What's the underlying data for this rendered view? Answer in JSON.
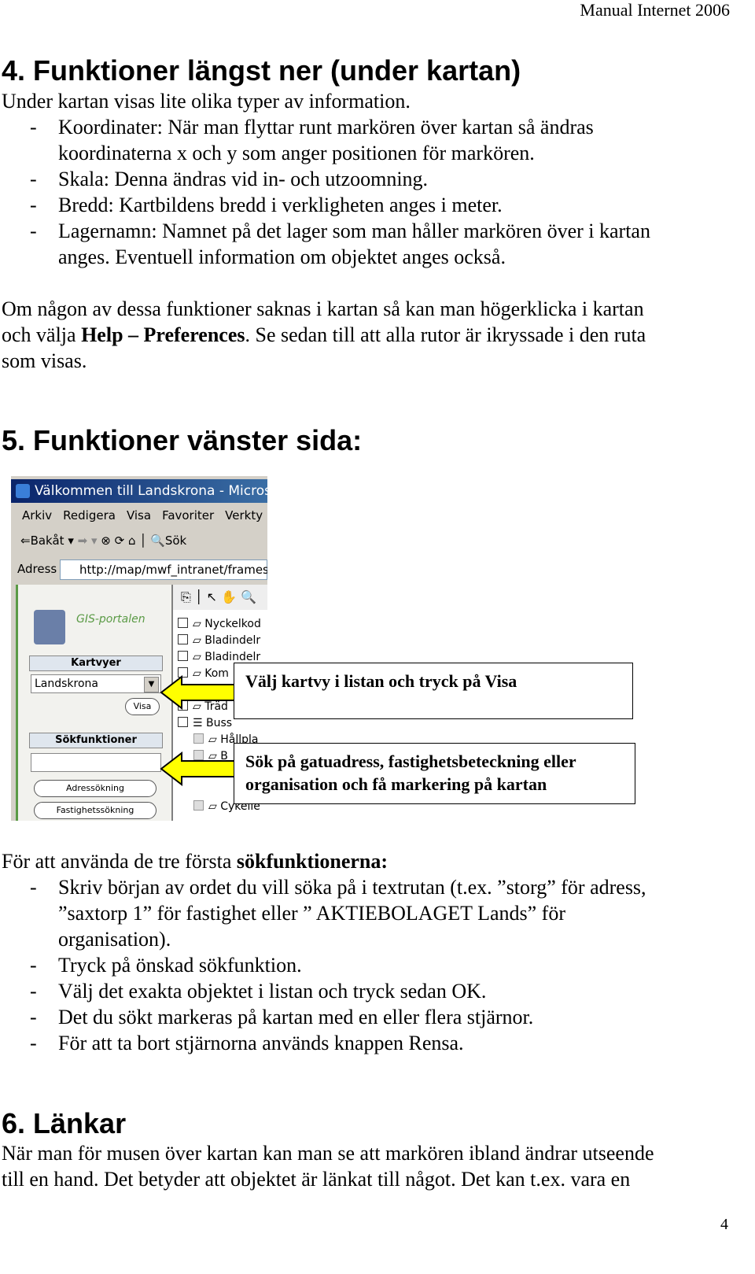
{
  "header": "Manual Internet 2006",
  "page_number": "4",
  "s4": {
    "title": "4. Funktioner längst ner (under kartan)",
    "lines": [
      "Under kartan visas lite olika typer av information.",
      "Koordinater: När man flyttar runt markören över kartan så ändras",
      "koordinaterna x och y som anger positionen för markören.",
      "Skala: Denna ändras vid in- och utzoomning.",
      "Bredd: Kartbildens bredd i verkligheten anges i meter.",
      "Lagernamn: Namnet på det lager som man håller markören över i kartan",
      "anges. Eventuell information om objektet anges också."
    ],
    "p1a": "Om någon av dessa funktioner saknas i kartan så kan man högerklicka i kartan",
    "p1b_pre": "och välja ",
    "p1b_bold": "Help – Preferences",
    "p1b_post": ". Se sedan till att alla rutor är ikryssade i den ruta",
    "p1c": "som visas."
  },
  "s5": {
    "title": "5. Funktioner vänster sida:",
    "screenshot": {
      "title": "Välkommen till Landskrona - Microsc",
      "menu": [
        "Arkiv",
        "Redigera",
        "Visa",
        "Favoriter",
        "Verkty"
      ],
      "back": "Bakåt",
      "search": "Sök",
      "address_label": "Adress",
      "address": "http://map/mwf_intranet/frames",
      "gis": "GIS-portalen",
      "kartvyer": "Kartvyer",
      "kartvy_value": "Landskrona",
      "visa": "Visa",
      "sokfunktioner": "Sökfunktioner",
      "search_value": "",
      "btn_adress": "Adressökning",
      "btn_fastighet": "Fastighetssökning",
      "layers": [
        "Nyckelkod",
        "Bladindelr",
        "Bladindelr",
        "Kom",
        "",
        "Träd",
        "Buss",
        "Hållpla",
        "B",
        "Cykelle",
        "Cykelle"
      ]
    },
    "callout1": "Välj kartvy i listan och tryck på Visa",
    "callout2a": "Sök på gatuadress, fastighetsbeteckning eller",
    "callout2b": "organisation och få markering på kartan",
    "intro_pre": "För att använda de tre första ",
    "intro_bold": "sökfunktionerna:",
    "lines": [
      "Skriv början av ordet du vill söka på i textrutan (t.ex. ”storg” för adress,",
      "”saxtorp 1” för fastighet eller ” AKTIEBOLAGET Lands” för",
      "organisation).",
      "Tryck på önskad sökfunktion.",
      "Välj det exakta objektet i listan och tryck sedan OK.",
      "Det du sökt markeras på kartan med en eller flera stjärnor.",
      "För att ta bort stjärnorna används knappen Rensa."
    ]
  },
  "s6": {
    "title": "6. Länkar",
    "lines": [
      "När man för musen över kartan kan man se att markören ibland ändrar utseende",
      "till en hand. Det betyder att objektet är länkat till något. Det kan t.ex. vara en"
    ]
  },
  "colors": {
    "arrow": "#ffff00",
    "titlebar": "#0a246a",
    "gis_green": "#5a9a45"
  }
}
